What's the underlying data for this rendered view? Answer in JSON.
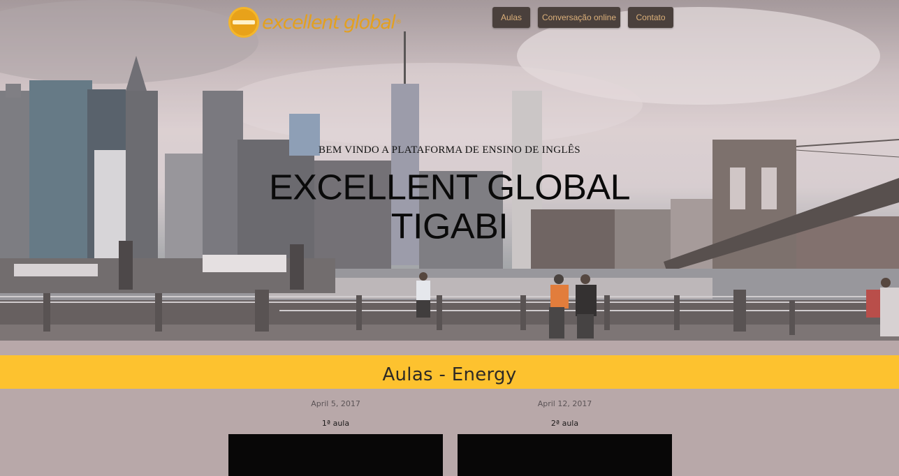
{
  "header": {
    "logo_text": "excellent global",
    "logo_reg": "®",
    "nav": [
      {
        "label": "Aulas"
      },
      {
        "label": "Conversação online"
      },
      {
        "label": "Contato"
      }
    ]
  },
  "hero": {
    "kicker": "BEM VINDO A PLATAFORMA DE ENSINO DE INGLÊS",
    "title_line1": "EXCELLENT GLOBAL",
    "title_line2": "TIGABI"
  },
  "section": {
    "title": "Aulas - Energy"
  },
  "lessons": [
    {
      "date": "April 5, 2017",
      "name": "1ª aula"
    },
    {
      "date": "April 12, 2017",
      "name": "2ª aula"
    }
  ],
  "colors": {
    "accent": "#fdc22f",
    "nav_bg": "#4a403c",
    "nav_text": "#dcb07a",
    "page_bg": "#b8a8a9",
    "logo": "#e3a020"
  },
  "icons": [
    "logo-icon"
  ]
}
